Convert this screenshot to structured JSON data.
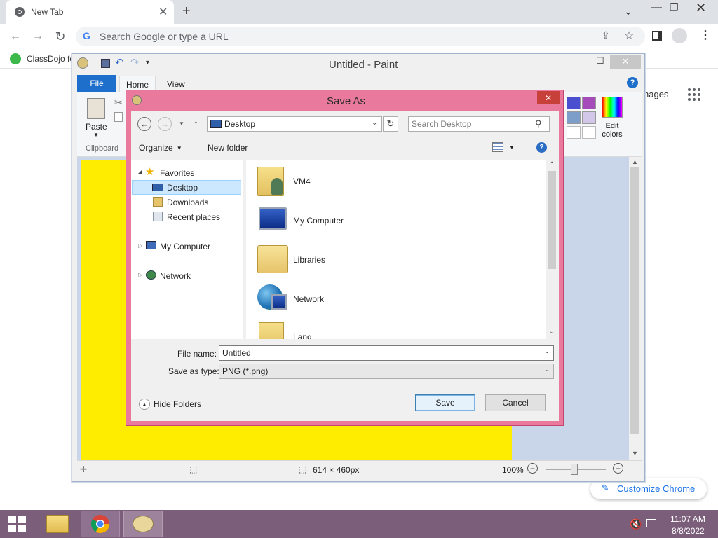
{
  "browser": {
    "tab_title": "New Tab",
    "omnibox_placeholder": "Search Google or type a URL",
    "bookmark_label": "ClassDojo fo",
    "ntp_link": "nages",
    "customize_label": "Customize Chrome"
  },
  "paint": {
    "title": "Untitled - Paint",
    "tabs": [
      "File",
      "Home",
      "View"
    ],
    "paste_label": "Paste",
    "clipboard_label": "Clipboard",
    "edit_colors_label": "Edit colors",
    "status": {
      "size": "614 × 460px",
      "zoom": "100%"
    }
  },
  "dialog": {
    "title": "Save As",
    "address": "Desktop",
    "search_placeholder": "Search Desktop",
    "organize_label": "Organize",
    "new_folder_label": "New folder",
    "nav": {
      "favorites": "Favorites",
      "items": [
        "Desktop",
        "Downloads",
        "Recent places"
      ],
      "my_computer": "My Computer",
      "network": "Network"
    },
    "files": [
      "VM4",
      "My Computer",
      "Libraries",
      "Network",
      "Lang"
    ],
    "file_name_label": "File name:",
    "file_name_value": "Untitled",
    "save_type_label": "Save as type:",
    "save_type_value": "PNG (*.png)",
    "hide_folders_label": "Hide Folders",
    "save_label": "Save",
    "cancel_label": "Cancel"
  },
  "taskbar": {
    "time": "11:07 AM",
    "date": "8/8/2022"
  },
  "colors": {
    "canvas": "#ffed00",
    "dialog_frame": "#e9799d",
    "taskbar": "#7b5e7a",
    "file_tab": "#1e6fcb"
  }
}
